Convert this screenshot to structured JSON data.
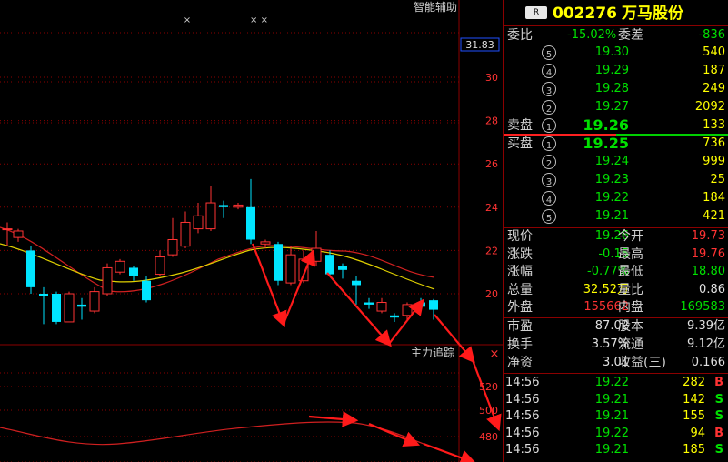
{
  "chart": {
    "indicator_title": "智能辅助",
    "price_tag": "31.83",
    "y_ticks": [
      "30",
      "28",
      "26",
      "24",
      "22",
      "20"
    ],
    "sub_title": "主力追踪",
    "sub_y_ticks": [
      "520",
      "500",
      "480"
    ],
    "close_symbol": "×",
    "top_marks": [
      "×",
      "× ×"
    ]
  },
  "header": {
    "badge": "R",
    "code": "002276",
    "name": "万马股份"
  },
  "ratio": {
    "label1": "委比",
    "value1": "-15.02%",
    "label2": "委差",
    "value2": "-836"
  },
  "asks": [
    {
      "idx": "5",
      "price": "19.30",
      "vol": "540"
    },
    {
      "idx": "4",
      "price": "19.29",
      "vol": "187"
    },
    {
      "idx": "3",
      "price": "19.28",
      "vol": "249"
    },
    {
      "idx": "2",
      "price": "19.27",
      "vol": "2092"
    },
    {
      "idx": "1",
      "price": "19.26",
      "vol": "133",
      "label": "卖盘"
    }
  ],
  "bids": [
    {
      "idx": "1",
      "price": "19.25",
      "vol": "736",
      "label": "买盘"
    },
    {
      "idx": "2",
      "price": "19.24",
      "vol": "999"
    },
    {
      "idx": "3",
      "price": "19.23",
      "vol": "25"
    },
    {
      "idx": "4",
      "price": "19.22",
      "vol": "184"
    },
    {
      "idx": "5",
      "price": "19.21",
      "vol": "421"
    }
  ],
  "stats": [
    {
      "l1": "现价",
      "v1": "19.26",
      "c1": "green",
      "l2": "今开",
      "v2": "19.73",
      "c2": "red"
    },
    {
      "l1": "涨跌",
      "v1": "-0.15",
      "c1": "green",
      "l2": "最高",
      "v2": "19.76",
      "c2": "red"
    },
    {
      "l1": "涨幅",
      "v1": "-0.77%",
      "c1": "green",
      "l2": "最低",
      "v2": "18.80",
      "c2": "green"
    },
    {
      "l1": "总量",
      "v1": "32.52万",
      "c1": "yellow",
      "l2": "量比",
      "v2": "0.86",
      "c2": "white"
    },
    {
      "l1": "外盘",
      "v1": "155662",
      "c1": "red",
      "l2": "内盘",
      "v2": "169583",
      "c2": "green"
    }
  ],
  "fundamentals": [
    {
      "l1": "市盈",
      "v1": "87.02",
      "l2": "股本",
      "v2": "9.39亿"
    },
    {
      "l1": "换手",
      "v1": "3.57%",
      "l2": "流通",
      "v2": "9.12亿"
    },
    {
      "l1": "净资",
      "v1": "3.01",
      "l2": "收益(三)",
      "v2": "0.166"
    }
  ],
  "ticks": [
    {
      "time": "14:56",
      "price": "19.22",
      "vol": "282",
      "side": "B"
    },
    {
      "time": "14:56",
      "price": "19.21",
      "vol": "142",
      "side": "S"
    },
    {
      "time": "14:56",
      "price": "19.21",
      "vol": "155",
      "side": "S"
    },
    {
      "time": "14:56",
      "price": "19.22",
      "vol": "94",
      "side": "B"
    },
    {
      "time": "14:56",
      "price": "19.21",
      "vol": "185",
      "side": "S"
    }
  ],
  "colors": {
    "up": "#ff3333",
    "down": "#00e5ff",
    "grid": "#8b0000",
    "ma_yellow": "#e0d000",
    "ma_red": "#d02020",
    "arrow": "#ff1a1a"
  }
}
